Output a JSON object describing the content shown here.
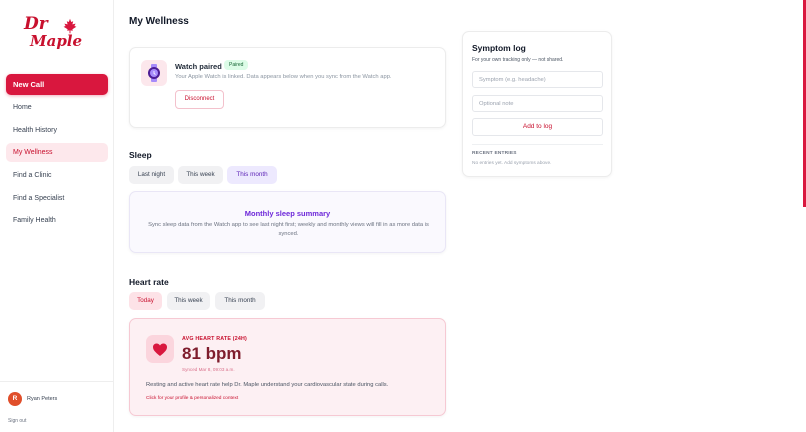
{
  "brand": {
    "line1": "Dr",
    "line2": "Maple",
    "accent": "#d9173e",
    "leaf_icon": "maple-leaf-icon"
  },
  "sidebar": {
    "new_call": "New Call",
    "items": [
      {
        "label": "Home",
        "active": false
      },
      {
        "label": "Health History",
        "active": false
      },
      {
        "label": "My Wellness",
        "active": true
      },
      {
        "label": "Find a Clinic",
        "active": false
      },
      {
        "label": "Find a Specialist",
        "active": false
      },
      {
        "label": "Family Health",
        "active": false
      }
    ],
    "user": {
      "initial": "R",
      "name": "Ryan Peters"
    },
    "sign_out": "Sign out"
  },
  "page": {
    "title": "My Wellness"
  },
  "watch": {
    "icon": "watch-icon",
    "title": "Watch paired",
    "badge": "Paired",
    "description": "Your Apple Watch is linked. Data appears below when you sync from the Watch app.",
    "disconnect": "Disconnect"
  },
  "sleep": {
    "title": "Sleep",
    "tabs": [
      "Last night",
      "This week",
      "This month"
    ],
    "selected_tab": "This month",
    "summary_title": "Monthly sleep summary",
    "summary_text": "Sync sleep data from the Watch app to see last night first; weekly and monthly views will fill in as more data is synced."
  },
  "heart": {
    "title": "Heart rate",
    "tabs": [
      "Today",
      "This week",
      "This month"
    ],
    "selected_tab": "Today",
    "icon": "heart-icon",
    "avg_label": "AVG HEART RATE (24H)",
    "value": "81 bpm",
    "synced": "Synced Mar 8, 09:03 a.m.",
    "description": "Resting and active heart rate help Dr. Maple understand your cardiovascular state during calls.",
    "link": "Click for your profile & personalized context"
  },
  "symptom_log": {
    "title": "Symptom log",
    "subtitle": "For your own tracking only — not shared.",
    "symptom_placeholder": "Symptom (e.g. headache)",
    "note_placeholder": "Optional note",
    "add_button": "Add to log",
    "recent_label": "RECENT ENTRIES",
    "empty_text": "No entries yet. Add symptoms above."
  }
}
